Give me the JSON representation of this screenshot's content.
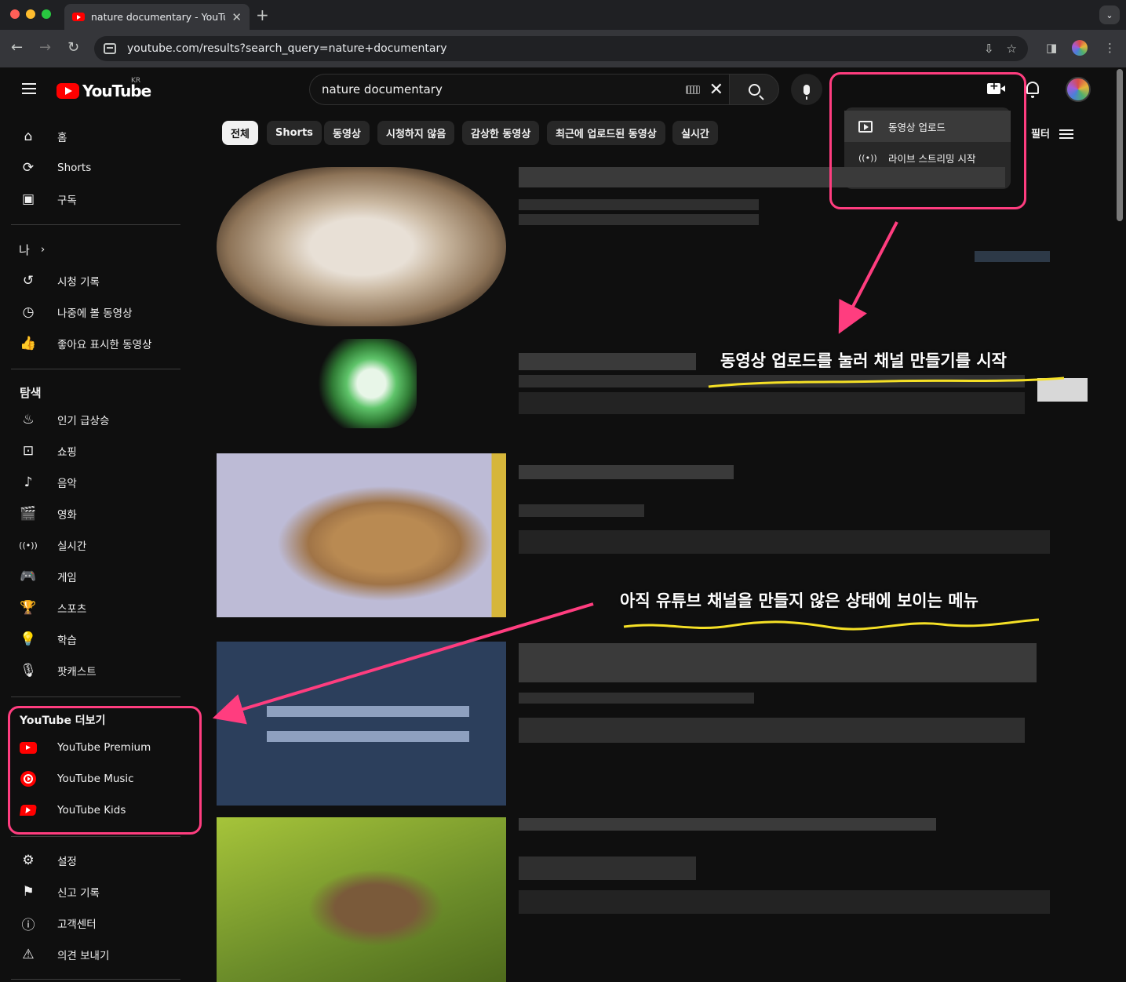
{
  "browser": {
    "tab_title": "nature documentary - YouTube",
    "url": "youtube.com/results?search_query=nature+documentary"
  },
  "header": {
    "logo_text": "YouTube",
    "region": "KR",
    "search_value": "nature documentary"
  },
  "create_menu": {
    "upload": "동영상 업로드",
    "live": "라이브 스트리밍 시작"
  },
  "chips": [
    "전체",
    "Shorts",
    "동영상",
    "시청하지 않음",
    "감상한 동영상",
    "최근에 업로드된 동영상",
    "실시간"
  ],
  "filter_label": "필터",
  "sidebar": {
    "main": [
      "홈",
      "Shorts",
      "구독"
    ],
    "you_header": "나",
    "you": [
      "시청 기록",
      "나중에 볼 동영상",
      "좋아요 표시한 동영상"
    ],
    "explore_header": "탐색",
    "explore": [
      "인기 급상승",
      "쇼핑",
      "음악",
      "영화",
      "실시간",
      "게임",
      "스포츠",
      "학습",
      "팟캐스트"
    ],
    "more_header": "YouTube 더보기",
    "more": [
      "YouTube Premium",
      "YouTube Music",
      "YouTube Kids"
    ],
    "footer": [
      "설정",
      "신고 기록",
      "고객센터",
      "의견 보내기"
    ]
  },
  "annotations": {
    "upload_hint": "동영상 업로드를 눌러 채널 만들기를 시작",
    "menu_hint": "아직 유튜브 채널을 만들지 않은 상태에 보이는 메뉴"
  },
  "colors": {
    "youtube_red": "#ff0000",
    "annotation_pink": "#ff3d7f",
    "annotation_yellow": "#f5e026"
  }
}
